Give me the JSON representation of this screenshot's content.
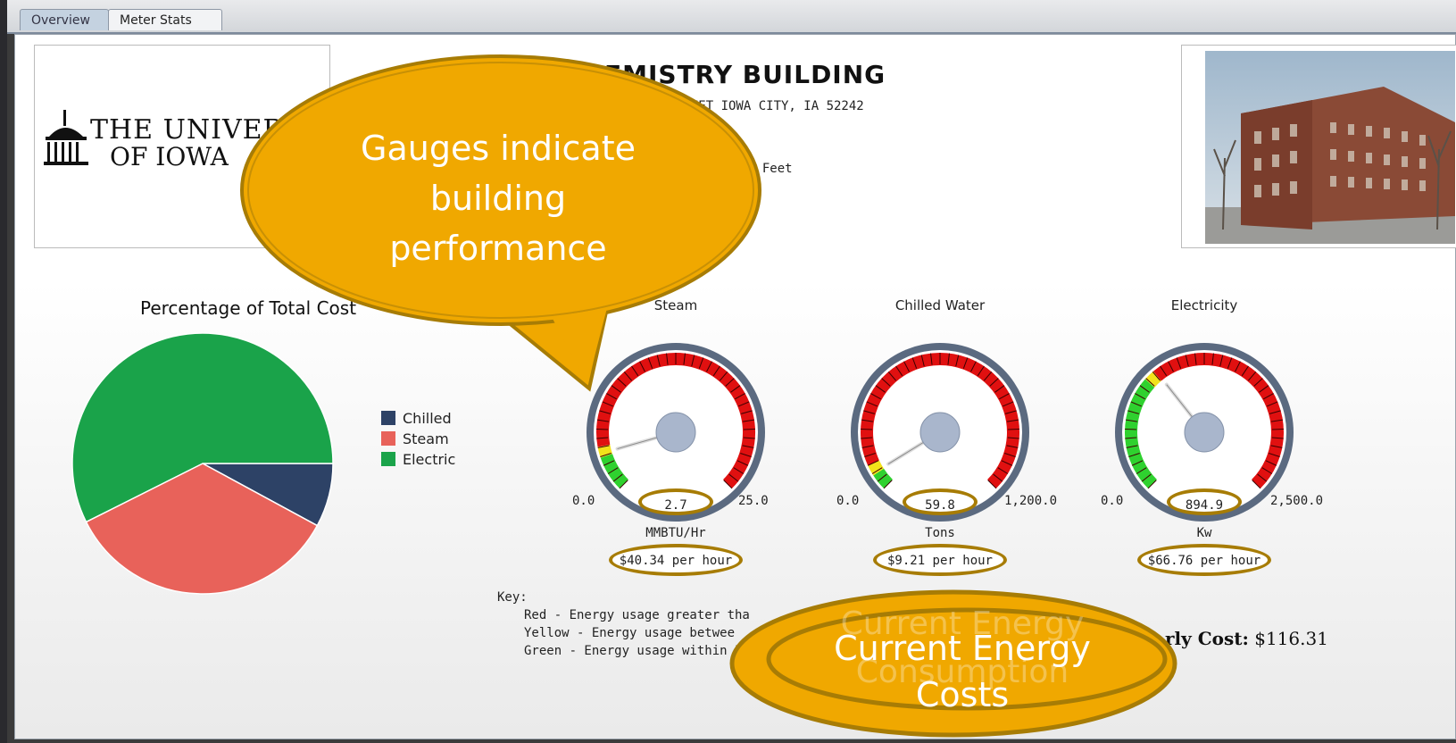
{
  "tabs": [
    {
      "label": "Overview",
      "active": false
    },
    {
      "label": "Meter Stats",
      "active": true
    }
  ],
  "logo": {
    "line1": "THE UNIVER",
    "line2": "OF IOWA"
  },
  "building": {
    "title": "EMISTRY BUILDING",
    "address": "TREET  IOWA CITY, IA  52242",
    "area": "e Feet"
  },
  "pie": {
    "title": "Percentage of Total Cost",
    "legend": [
      {
        "label": "Chilled",
        "color": "#2d4266"
      },
      {
        "label": "Steam",
        "color": "#e8625a"
      },
      {
        "label": "Electric",
        "color": "#1aa34a"
      }
    ]
  },
  "chart_data": {
    "type": "pie",
    "title": "Percentage of Total Cost",
    "categories": [
      "Chilled",
      "Steam",
      "Electric"
    ],
    "values": [
      7.9,
      34.7,
      57.4
    ],
    "colors": [
      "#2d4266",
      "#e8625a",
      "#1aa34a"
    ]
  },
  "gauges": [
    {
      "name": "Steam",
      "min": "0.0",
      "max": "25.0",
      "value": "2.7",
      "value_num": 2.7,
      "range_max": 25,
      "unit": "MMBTU/Hr",
      "cost": "$40.34  per hour"
    },
    {
      "name": "Chilled Water",
      "min": "0.0",
      "max": "1,200.0",
      "value": "59.8",
      "value_num": 59.8,
      "range_max": 1200,
      "unit": "Tons",
      "cost": "$9.21  per hour"
    },
    {
      "name": "Electricity",
      "min": "0.0",
      "max": "2,500.0",
      "value": "894.9",
      "value_num": 894.9,
      "range_max": 2500,
      "unit": "Kw",
      "cost": "$66.76  per hour"
    }
  ],
  "key": {
    "title": "Key:",
    "red": "Red - Energy usage greater tha",
    "yellow": "Yellow - Energy usage betwee",
    "green": "Green - Energy usage within 5"
  },
  "total": {
    "label": "rly Cost:",
    "value": "$116.31"
  },
  "callouts": {
    "gauges": "Gauges indicate building performance",
    "costs": "Current Energy Costs",
    "ghost": "Current Energy Consumption"
  },
  "colors": {
    "callout_fill": "#f0a800",
    "callout_border": "#a77c05"
  }
}
